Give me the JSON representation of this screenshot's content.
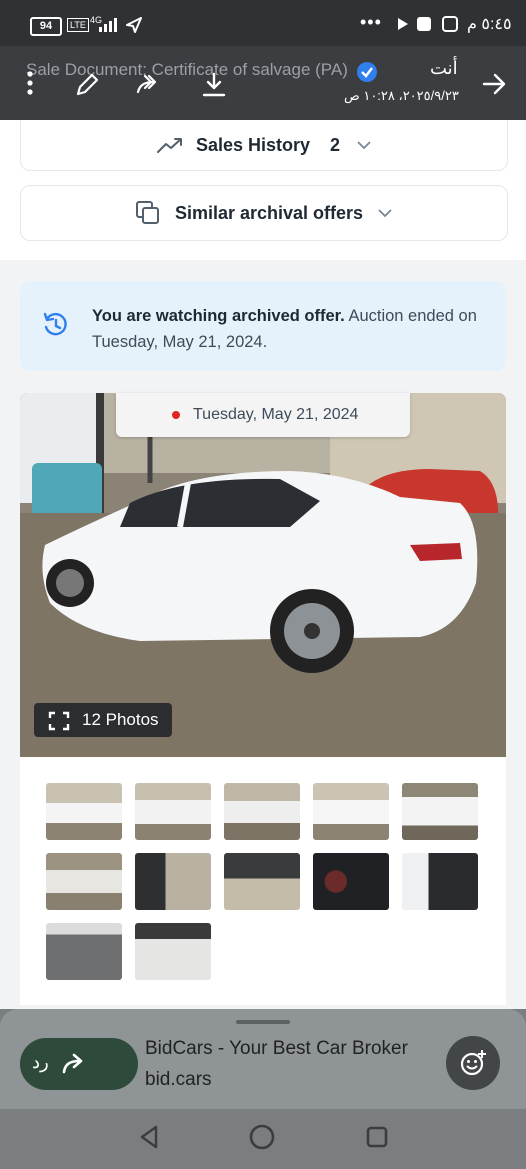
{
  "status_bar": {
    "battery": "94",
    "volte": "LTE",
    "network": "4G",
    "time": "٥:٤٥ م"
  },
  "viewer_header": {
    "sender": "أنت",
    "sent_date": "٢٠٢٥/٩/٢٣، ١٠:٢٨ ص",
    "ghost_text": "Sale Document: Certificate of salvage (PA)"
  },
  "page": {
    "sales_history": {
      "label": "Sales History",
      "count": "2"
    },
    "similar_offers": {
      "label": "Similar archival offers"
    },
    "notice": {
      "bold": "You are watching archived offer.",
      "rest": " Auction ended on Tuesday, May 21, 2024."
    },
    "gallery": {
      "date": "Tuesday, May 21, 2024",
      "photos_label": "12 Photos",
      "thumbnail_count": 12
    }
  },
  "share_sheet": {
    "reply_label": "رد",
    "link_title": "BidCars - Your Best Car Broker",
    "link_domain": "bid.cars"
  },
  "colors": {
    "accent_blue": "#2f80ed",
    "notice_bg": "#e6f2fb",
    "reply_green": "#2e4a3a",
    "status_red": "#e02424"
  }
}
